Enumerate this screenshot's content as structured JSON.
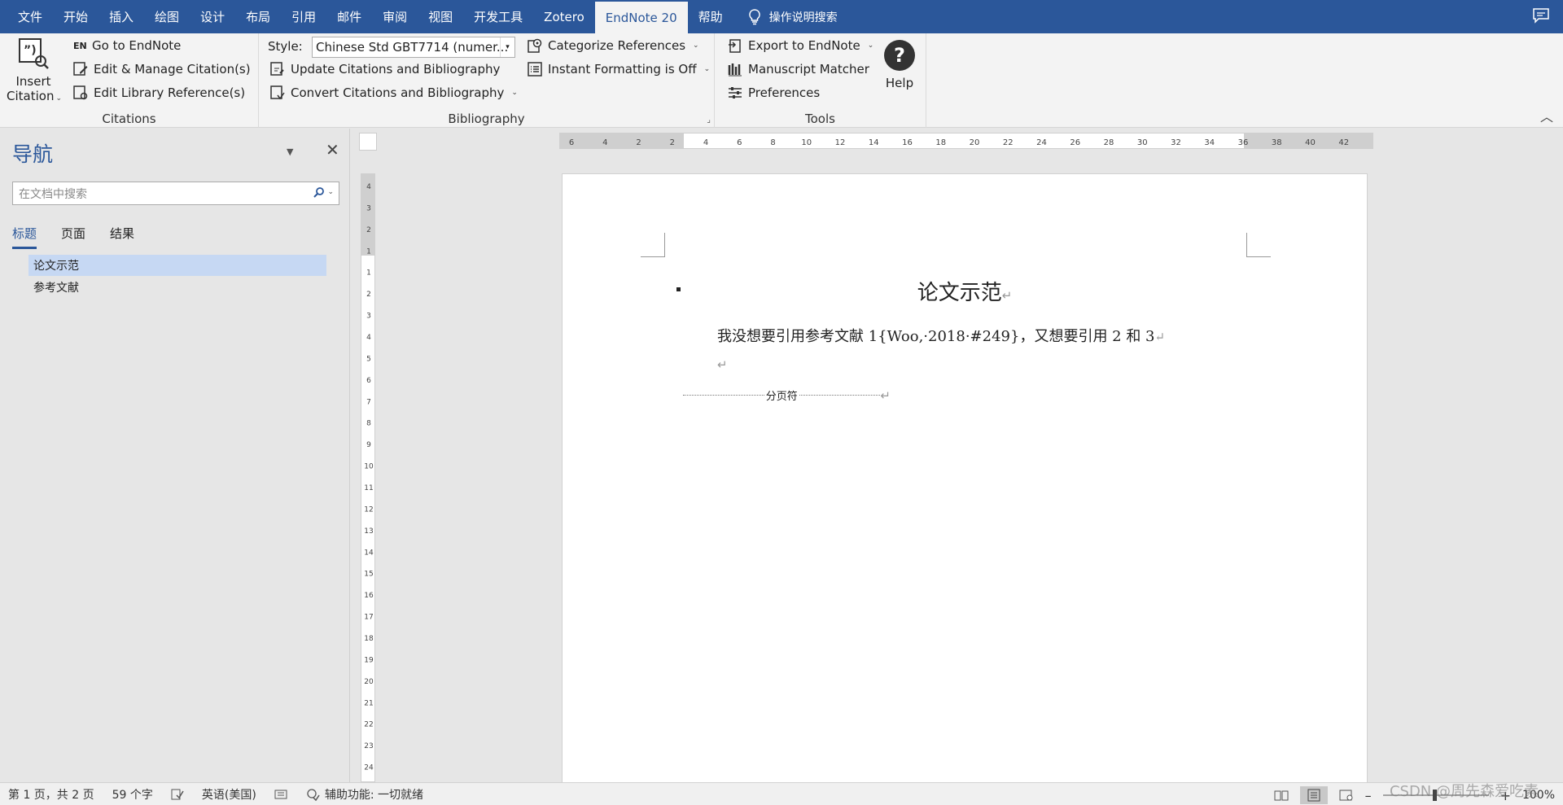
{
  "colors": {
    "accent": "#2b579a",
    "selected_heading": "#c6d8f3"
  },
  "menubar": {
    "tabs": [
      "文件",
      "开始",
      "插入",
      "绘图",
      "设计",
      "布局",
      "引用",
      "邮件",
      "审阅",
      "视图",
      "开发工具",
      "Zotero",
      "EndNote 20",
      "帮助"
    ],
    "active_tab": "EndNote 20",
    "tell_me": "操作说明搜索",
    "comment_icon": "comment-icon"
  },
  "ribbon": {
    "citations": {
      "insert_label_1": "Insert",
      "insert_label_2": "Citation",
      "go_to": "Go to EndNote",
      "edit_manage": "Edit & Manage Citation(s)",
      "edit_library": "Edit Library Reference(s)",
      "group_label": "Citations"
    },
    "bibliography": {
      "style_label": "Style:",
      "style_value": "Chinese Std GBT7714 (numer...",
      "update": "Update Citations and Bibliography",
      "convert": "Convert Citations and Bibliography",
      "categorize": "Categorize References",
      "instant": "Instant Formatting is Off",
      "group_label": "Bibliography"
    },
    "tools": {
      "export": "Export to EndNote",
      "matcher": "Manuscript Matcher",
      "preferences": "Preferences",
      "help": "Help",
      "group_label": "Tools"
    }
  },
  "nav": {
    "title": "导航",
    "search_placeholder": "在文档中搜索",
    "tabs": [
      "标题",
      "页面",
      "结果"
    ],
    "headings": [
      "论文示范",
      "参考文献"
    ]
  },
  "hruler_labels": [
    "6",
    "4",
    "2",
    "2",
    "4",
    "6",
    "8",
    "10",
    "12",
    "14",
    "16",
    "18",
    "20",
    "22",
    "24",
    "26",
    "28",
    "30",
    "32",
    "34",
    "36",
    "38",
    "40",
    "42"
  ],
  "vruler_labels": [
    "4",
    "3",
    "2",
    "1",
    "1",
    "2",
    "3",
    "4",
    "5",
    "6",
    "7",
    "8",
    "9",
    "10",
    "11",
    "12",
    "13",
    "14",
    "15",
    "16",
    "17",
    "18",
    "19",
    "20",
    "21",
    "22",
    "23",
    "24"
  ],
  "document": {
    "title": "论文示范",
    "paragraph": "我没想要引用参考文献 1{Woo,·2018·#249}，又想要引用 2 和 3",
    "pilcrow": "↵",
    "page_break": "分页符"
  },
  "status": {
    "page": "第 1 页，共 2 页",
    "words": "59 个字",
    "language": "英语(美国)",
    "accessibility": "辅助功能: 一切就绪",
    "zoom": "100%"
  },
  "watermark": "CSDN @周先森爱吃素"
}
